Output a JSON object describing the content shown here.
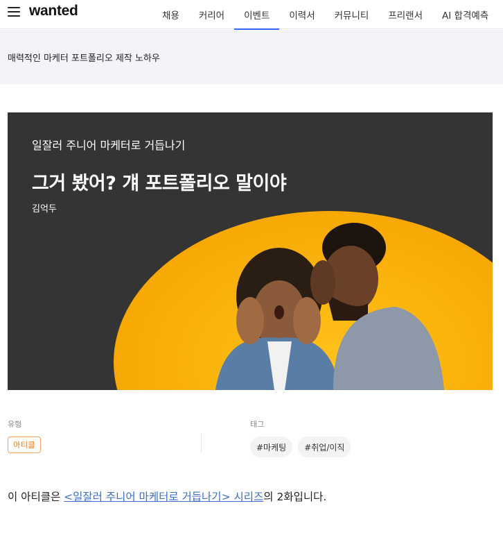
{
  "header": {
    "logo": "wanted",
    "nav": [
      {
        "label": "채용",
        "active": false
      },
      {
        "label": "커리어",
        "active": false
      },
      {
        "label": "이벤트",
        "active": true
      },
      {
        "label": "이력서",
        "active": false
      },
      {
        "label": "커뮤니티",
        "active": false
      },
      {
        "label": "프리랜서",
        "active": false
      },
      {
        "label": "AI 합격예측",
        "active": false
      }
    ]
  },
  "page": {
    "title": "매력적인 마케터 포트폴리오 제작 노하우"
  },
  "banner": {
    "series": "일잘러 주니어 마케터로 거듭나기",
    "title": "그거 봤어? 걔 포트폴리오 말이야",
    "author": "김억두",
    "background_color": "#343434",
    "accent_color": "#f5a300"
  },
  "meta": {
    "type_label": "유형",
    "type_value": "아티클",
    "tags_label": "태그",
    "tags": [
      "#마케팅",
      "#취업/이직"
    ]
  },
  "intro": {
    "prefix": "이 아티클은 ",
    "link": "<일잘러 주니어 마케터로 거듭나기> 시리즈",
    "suffix": "의 2화입니다."
  }
}
